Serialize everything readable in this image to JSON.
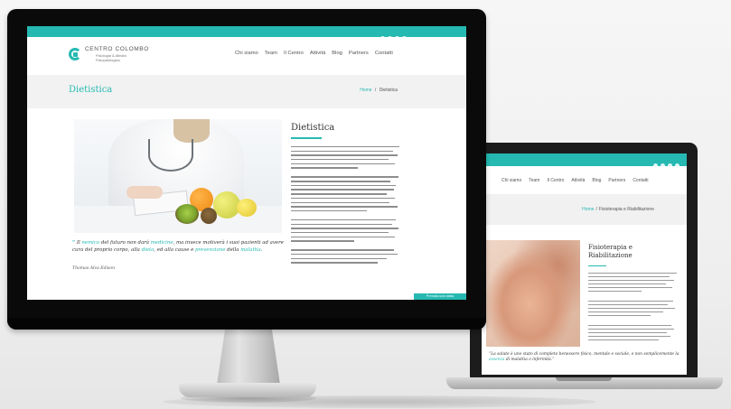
{
  "monitor": {
    "site": {
      "logo_name": "CENTRO COLOMBO",
      "logo_sub_line1": "Fisiologia & Attività",
      "logo_sub_line2": "Fisiopatologica",
      "nav": [
        "Chi siamo",
        "Team",
        "Il Centro",
        "Attività",
        "Blog",
        "Partners",
        "Contatti"
      ],
      "page_title": "Dietistica",
      "breadcrumb": {
        "home": "Home",
        "separator": "/",
        "current": "Dietistica"
      },
      "content_title": "Dietistica",
      "quote": {
        "open": "“",
        "p1": "Il",
        "h1": "nemico",
        "p2": "del futuro non darà",
        "h2": "medicine",
        "p3": ", ma invece motiverà i suoi pazienti ad avere cura del proprio corpo, alla",
        "h3": "dieta",
        "p4": ", ed alla cause e",
        "h4": "prevenzione",
        "p5": "della",
        "h5": "malattia",
        "p6": ".",
        "author": "Thomas Alva Edison"
      },
      "badge": "Prenota una visita"
    }
  },
  "laptop": {
    "site": {
      "nav": [
        "Chi siamo",
        "Team",
        "Il Centro",
        "Attività",
        "Blog",
        "Partners",
        "Contatti"
      ],
      "breadcrumb": {
        "home": "Home",
        "separator": "/",
        "current": "Fisioterapia e Riabilitazione"
      },
      "content_title_line1": "Fisioterapia e",
      "content_title_line2": "Riabilitazione",
      "quote": {
        "p1": "“La salute è uno stato di completo benessere fisico, mentale e sociale, e non semplicemente la ",
        "h1": "assenza",
        "p2": " di malattia o infermità.”"
      }
    }
  },
  "colors": {
    "accent": "#25b9b2",
    "frame": "#0a0a0a",
    "background": "#f1f1f1"
  }
}
